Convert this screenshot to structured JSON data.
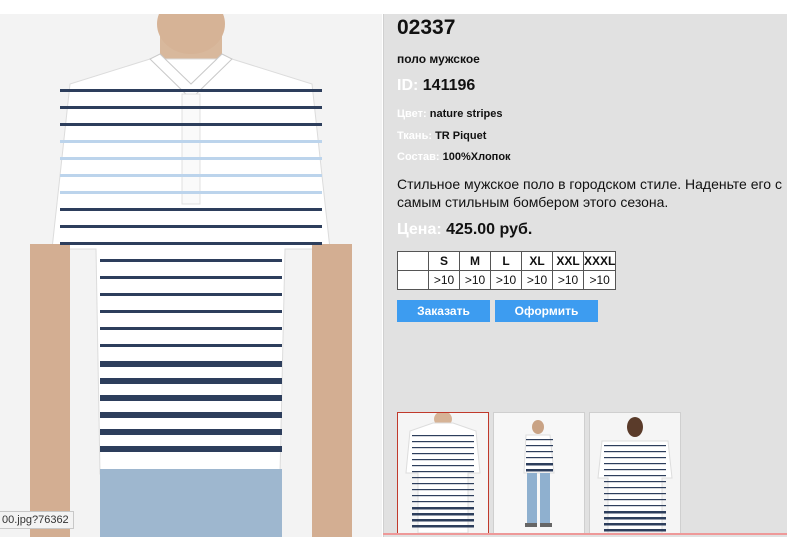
{
  "product": {
    "code": "02337",
    "subtitle": "поло мужское",
    "id_label": "ID:",
    "id_value": "141196",
    "attributes": [
      {
        "label": "Цвет:",
        "value": "nature stripes"
      },
      {
        "label": "Ткань:",
        "value": "TR Piquet"
      },
      {
        "label": "Состав:",
        "value": "100%Хлопок"
      }
    ],
    "description": "Стильное мужское поло в городском стиле. Наденьте его с самым стильным бомбером этого сезона.",
    "price_label": "Цена:",
    "price_value": "425.00 руб."
  },
  "sizes": {
    "headers": [
      "S",
      "M",
      "L",
      "XL",
      "XXL",
      "XXXL"
    ],
    "availability": [
      ">10",
      ">10",
      ">10",
      ">10",
      ">10",
      ">10"
    ]
  },
  "buttons": {
    "order": "Заказать",
    "checkout": "Оформить"
  },
  "status_tip": "00.jpg?76362",
  "colors": {
    "accent_button": "#3d9cf0",
    "panel_bg": "#e1e1e1",
    "stripe_navy": "#2d3e5c",
    "stripe_light": "#bcd4ec"
  }
}
